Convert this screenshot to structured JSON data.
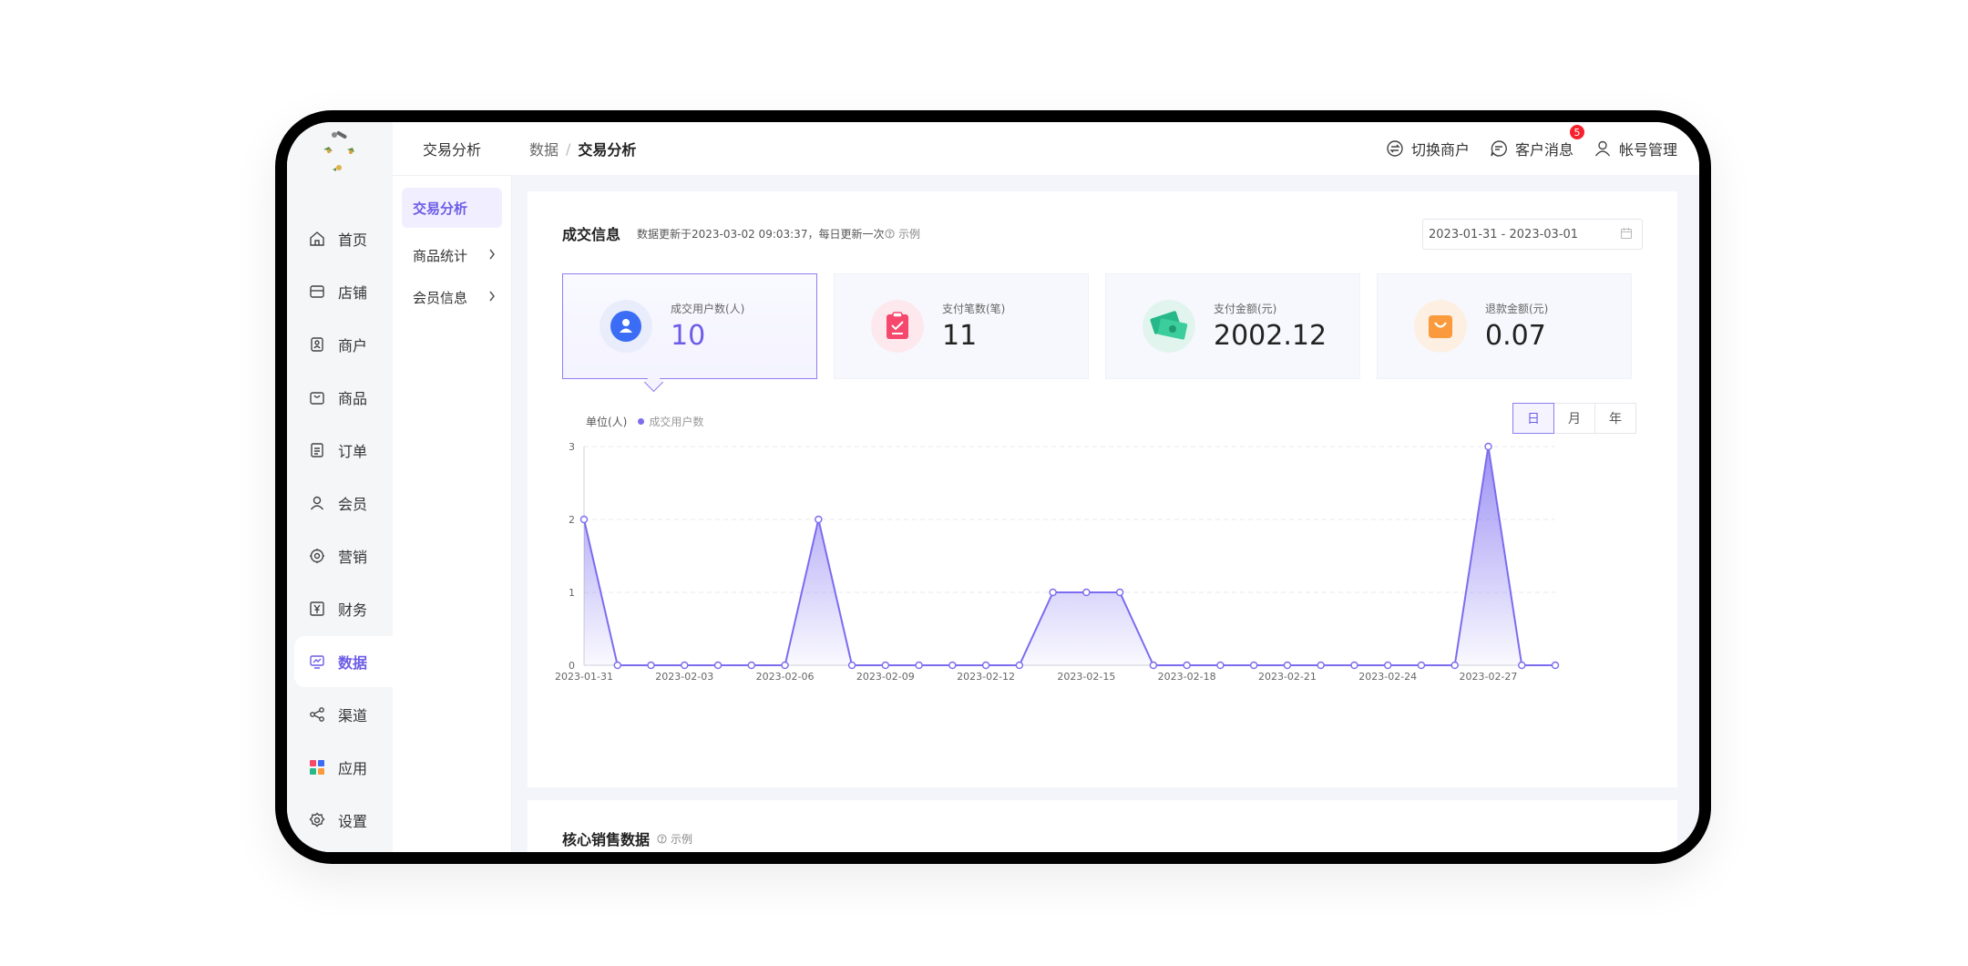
{
  "breadcrumb": {
    "parent": "数据",
    "separator": "/",
    "current": "交易分析"
  },
  "header": {
    "actions": [
      {
        "label": "切换商户",
        "icon": "switch-icon"
      },
      {
        "label": "客户消息",
        "icon": "message-icon",
        "badge": "5"
      },
      {
        "label": "帐号管理",
        "icon": "user-icon"
      }
    ]
  },
  "sidebar": {
    "items": [
      {
        "label": "首页",
        "icon": "home-icon"
      },
      {
        "label": "店铺",
        "icon": "shop-icon"
      },
      {
        "label": "商户",
        "icon": "merchant-icon"
      },
      {
        "label": "商品",
        "icon": "product-bag-icon"
      },
      {
        "label": "订单",
        "icon": "order-icon"
      },
      {
        "label": "会员",
        "icon": "member-icon"
      },
      {
        "label": "营销",
        "icon": "marketing-icon"
      },
      {
        "label": "财务",
        "icon": "finance-icon"
      },
      {
        "label": "数据",
        "icon": "data-monitor-icon",
        "active": true
      },
      {
        "label": "渠道",
        "icon": "channel-icon"
      },
      {
        "label": "应用",
        "icon": "apps-icon"
      },
      {
        "label": "设置",
        "icon": "settings-icon"
      }
    ]
  },
  "submenu": {
    "title": "交易分析",
    "items": [
      {
        "label": "交易分析",
        "active": true
      },
      {
        "label": "商品统计"
      },
      {
        "label": "会员信息"
      }
    ]
  },
  "transaction": {
    "title": "成交信息",
    "note": "数据更新于2023-03-02 09:03:37，每日更新一次",
    "help": "示例",
    "date_range": "2023-01-31 - 2023-03-01",
    "stats": [
      {
        "label": "成交用户数(人)",
        "value": "10",
        "icon": "user-icon",
        "color": "#3b6cf5",
        "bg": "#e9edfb"
      },
      {
        "label": "支付笔数(笔)",
        "value": "11",
        "icon": "receipt-icon",
        "color": "#f5486c",
        "bg": "#fde8ee"
      },
      {
        "label": "支付金额(元)",
        "value": "2002.12",
        "icon": "money-icon",
        "color": "#27b88a",
        "bg": "#e1f5ee"
      },
      {
        "label": "退款金额(元)",
        "value": "0.07",
        "icon": "bag-icon",
        "color": "#fa9a3c",
        "bg": "#fdf0e3"
      }
    ],
    "unit_label": "单位(人)",
    "periods": [
      {
        "label": "日",
        "active": true
      },
      {
        "label": "月"
      },
      {
        "label": "年"
      }
    ]
  },
  "colors": {
    "accent": "#6c5ce7",
    "line": "#7b6cf0"
  },
  "chart_data": {
    "type": "area",
    "x": [
      "2023-01-31",
      "2023-02-01",
      "2023-02-02",
      "2023-02-03",
      "2023-02-04",
      "2023-02-05",
      "2023-02-06",
      "2023-02-07",
      "2023-02-08",
      "2023-02-09",
      "2023-02-10",
      "2023-02-11",
      "2023-02-12",
      "2023-02-13",
      "2023-02-14",
      "2023-02-15",
      "2023-02-16",
      "2023-02-17",
      "2023-02-18",
      "2023-02-19",
      "2023-02-20",
      "2023-02-21",
      "2023-02-22",
      "2023-02-23",
      "2023-02-24",
      "2023-02-25",
      "2023-02-26",
      "2023-02-27",
      "2023-02-28",
      "2023-03-01"
    ],
    "tick_labels": [
      "2023-01-31",
      "2023-02-03",
      "2023-02-06",
      "2023-02-09",
      "2023-02-12",
      "2023-02-15",
      "2023-02-18",
      "2023-02-21",
      "2023-02-24",
      "2023-02-27"
    ],
    "series": [
      {
        "name": "成交用户数",
        "values": [
          2,
          0,
          0,
          0,
          0,
          0,
          0,
          2,
          0,
          0,
          0,
          0,
          0,
          0,
          1,
          1,
          1,
          0,
          0,
          0,
          0,
          0,
          0,
          0,
          0,
          0,
          0,
          3,
          0,
          0
        ]
      }
    ],
    "yticks": [
      0,
      1,
      2,
      3
    ],
    "ylim": [
      0,
      3
    ],
    "ylabel": "单位(人)",
    "grid": true,
    "legend": "top-left"
  },
  "core_sales": {
    "title": "核心销售数据",
    "help": "示例"
  }
}
